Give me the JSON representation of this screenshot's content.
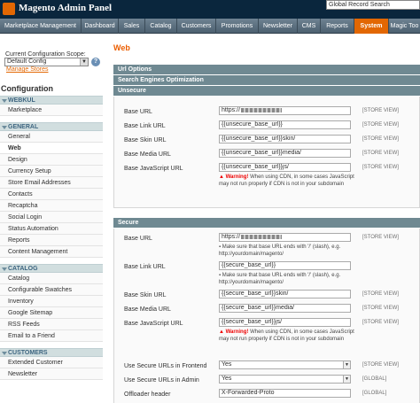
{
  "header": {
    "title": "Magento Admin Panel",
    "search_value": "Global Record Search"
  },
  "nav": [
    "Marketplace Management",
    "Dashboard",
    "Sales",
    "Catalog",
    "Customers",
    "Promotions",
    "Newsletter",
    "CMS",
    "Reports",
    "System",
    "Magic Too"
  ],
  "nav_active": "System",
  "scope": {
    "label": "Current Configuration Scope:",
    "value": "Default Config",
    "manage_link": "Manage Stores"
  },
  "configuration_title": "Configuration",
  "sidebar": {
    "webkul": {
      "title": "WEBKUL",
      "items": [
        "Marketplace"
      ]
    },
    "general": {
      "title": "GENERAL",
      "items": [
        "General",
        "Web",
        "Design",
        "Currency Setup",
        "Store Email Addresses",
        "Contacts",
        "Recaptcha",
        "Social Login",
        "Status Automation",
        "Reports",
        "Content Management"
      ]
    },
    "catalog": {
      "title": "CATALOG",
      "items": [
        "Catalog",
        "Configurable Swatches",
        "Inventory",
        "Google Sitemap",
        "RSS Feeds",
        "Email to a Friend"
      ]
    },
    "customers": {
      "title": "CUSTOMERS",
      "items": [
        "Extended Customer",
        "Newsletter"
      ]
    }
  },
  "main": {
    "title": "Web",
    "sections": {
      "url_options": "Url Options",
      "seo": "Search Engines Optimization",
      "unsecure": "Unsecure",
      "secure": "Secure"
    },
    "store_view": "[STORE VIEW]",
    "global": "[GLOBAL]",
    "unsecure": {
      "base_url": {
        "label": "Base URL",
        "value": "https://"
      },
      "base_link_url": {
        "label": "Base Link URL",
        "value": "{{unsecure_base_url}}"
      },
      "base_skin_url": {
        "label": "Base Skin URL",
        "value": "{{unsecure_base_url}}skin/"
      },
      "base_media_url": {
        "label": "Base Media URL",
        "value": "{{unsecure_base_url}}media/"
      },
      "base_js_url": {
        "label": "Base JavaScript URL",
        "value": "{{unsecure_base_url}}js/"
      },
      "warning_bold": "Warning!",
      "warning_text": "When using CDN, in some cases JavaScript may not run properly if CDN is not in your subdomain"
    },
    "secure": {
      "base_url": {
        "label": "Base URL",
        "value": "https://"
      },
      "base_url_note": "Make sure that base URL ends with '/' (slash), e.g. http://yourdomain/magento/",
      "base_link_url": {
        "label": "Base Link URL",
        "value": "{{secure_base_url}}"
      },
      "base_link_note": "Make sure that base URL ends with '/' (slash), e.g. http://yourdomain/magento/",
      "base_skin_url": {
        "label": "Base Skin URL",
        "value": "{{secure_base_url}}skin/"
      },
      "base_media_url": {
        "label": "Base Media URL",
        "value": "{{secure_base_url}}media/"
      },
      "base_js_url": {
        "label": "Base JavaScript URL",
        "value": "{{secure_base_url}}js/"
      },
      "warning_bold": "Warning!",
      "warning_text": "When using CDN, in some cases JavaScript may not run properly if CDN is not in your subdomain",
      "use_frontend": {
        "label": "Use Secure URLs in Frontend",
        "value": "Yes"
      },
      "use_admin": {
        "label": "Use Secure URLs in Admin",
        "value": "Yes"
      },
      "offloader": {
        "label": "Offloader header",
        "value": "X-Forwarded-Proto"
      }
    }
  },
  "colors": {
    "header_bg": "#0a263d",
    "accent": "#e26703",
    "section_head": "#6f8992",
    "warning": "#ee0000"
  }
}
